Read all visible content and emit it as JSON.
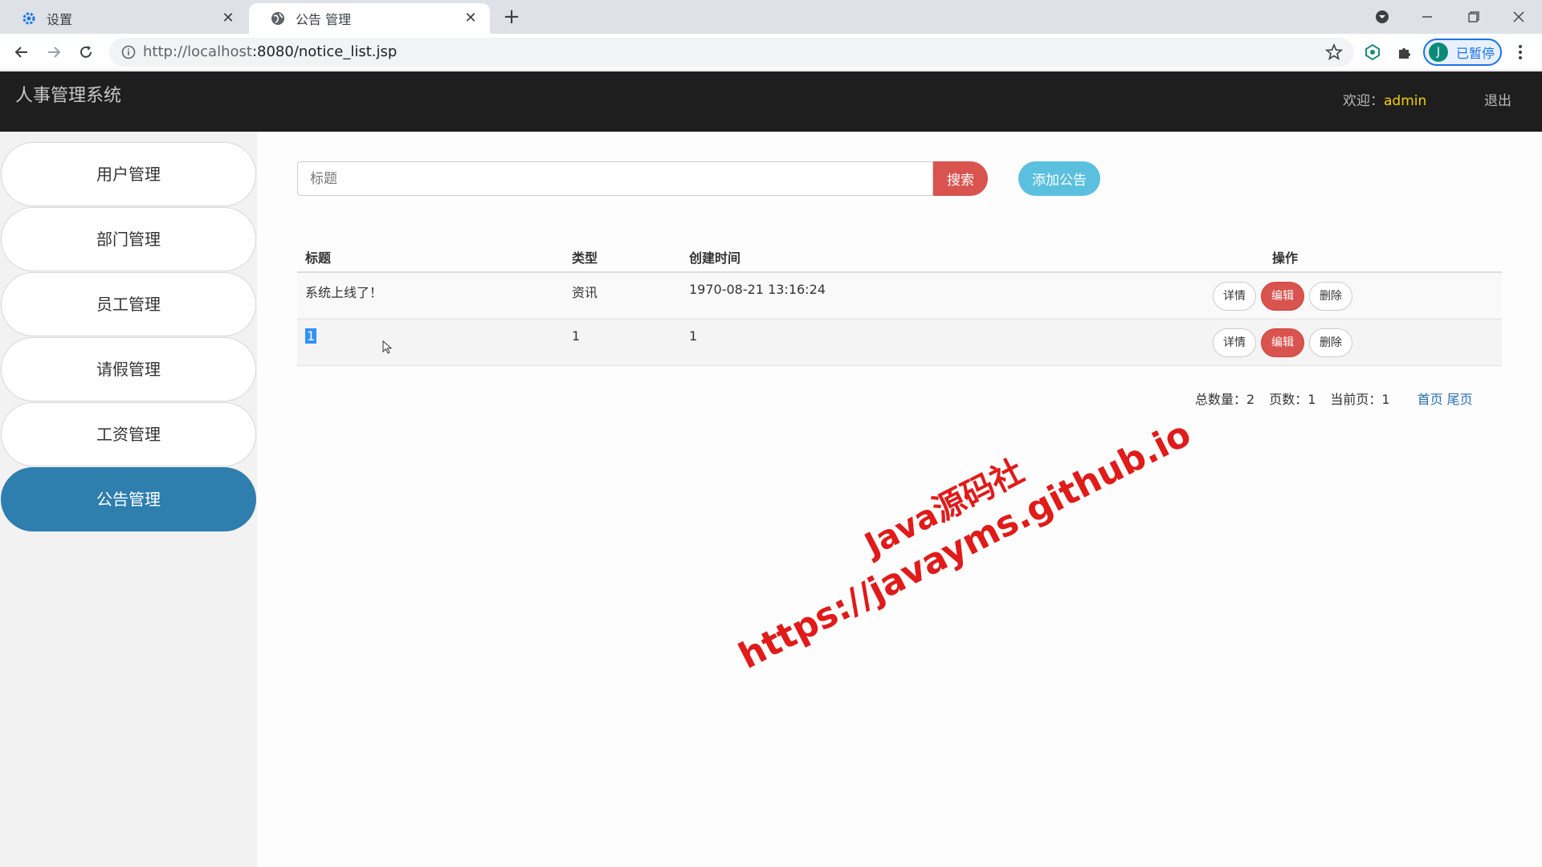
{
  "browser": {
    "tabs": [
      {
        "title": "设置"
      },
      {
        "title": "公告 管理"
      }
    ],
    "url_host": "http://localhost",
    "url_rest": ":8080/notice_list.jsp",
    "profile_initial": "J",
    "profile_status": "已暂停"
  },
  "header": {
    "brand": "人事管理系统",
    "welcome_prefix": "欢迎：",
    "username": "admin",
    "logout": "退出"
  },
  "sidebar": {
    "items": [
      {
        "label": "用户管理"
      },
      {
        "label": "部门管理"
      },
      {
        "label": "员工管理"
      },
      {
        "label": "请假管理"
      },
      {
        "label": "工资管理"
      },
      {
        "label": "公告管理"
      }
    ],
    "active_index": 5
  },
  "search": {
    "placeholder": "标题",
    "button": "搜索",
    "add_button": "添加公告"
  },
  "table": {
    "headers": [
      "标题",
      "类型",
      "创建时间",
      "操作"
    ],
    "rows": [
      {
        "title": "系统上线了！",
        "type": "资讯",
        "created": "1970-08-21 13:16:24"
      },
      {
        "title": "1",
        "type": "1",
        "created": "1"
      }
    ],
    "actions": {
      "detail": "详情",
      "edit": "编辑",
      "delete": "删除"
    }
  },
  "pager": {
    "total": "总数量：2",
    "pages": "页数：1",
    "current": "当前页：1",
    "first": "首页",
    "last": "尾页"
  },
  "watermark": {
    "line1": "Java源码社",
    "line2": "https://javayms.github.io"
  },
  "colors": {
    "header_bg": "#1e1e1e",
    "sidebar_active": "#2e7eae",
    "danger": "#d9534f",
    "info": "#5bc0de",
    "link": "#2a6fb0"
  }
}
